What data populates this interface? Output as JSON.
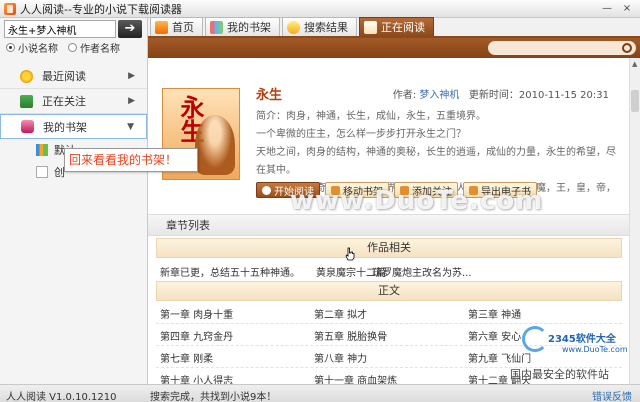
{
  "window": {
    "title": "人人阅读--专业的小说下载阅读器",
    "minimize": "—",
    "close": "×"
  },
  "search": {
    "value": "永生+梦入神机",
    "go": "➔",
    "option_title": "小说名称",
    "option_author": "作者名称"
  },
  "nav": {
    "recent": "最近阅读",
    "follow": "正在关注",
    "shelf": "我的书架",
    "sub_default": "默认",
    "sub_create": "创"
  },
  "tooltip": "回来看看我的书架！",
  "tabs": {
    "home": "首页",
    "shelf": "我的书架",
    "results": "搜索结果",
    "reading": "正在阅读"
  },
  "book": {
    "cover_title": "永生",
    "title": "永生",
    "author_label": "作者:",
    "author": "梦入神机",
    "updated_label": "更新时间：",
    "updated": "2010-11-15 20:31",
    "desc_line1": "简介：肉身，神通，长生，成仙，永生，五重境界。",
    "desc_line2": "一个卑微的庄主，怎么样一步步打开永生之门？",
    "desc_line3": "天地之间，肉身的结构，神通的奥秘，长生的逍遥，成仙的力量，永生的希望，尽在其中。",
    "desc_line4": "无穷无尽的新奇法宝，崭新世界，仙道门派，人，妖，神，仙，魔，王，皇，帝，人间的爱"
  },
  "actions": {
    "start": "开始阅读",
    "move": "移动书架",
    "follow": "添加关注",
    "export": "导出电子书"
  },
  "chapters": {
    "header": "章节列表",
    "group1": "作品相关",
    "group1_items": [
      "新章已更，总结五十五种神通。",
      "黄泉魔宗十二篇",
      "疏罗魔炮主改名为苏..."
    ],
    "group2": "正文",
    "rows": [
      [
        "第一章 肉身十重",
        "第二章 拟才",
        "第三章 神通"
      ],
      [
        "第四章 九窍金丹",
        "第五章 脱胎换骨",
        "第六章 安心"
      ],
      [
        "第七章 刚柔",
        "第八章 神力",
        "第九章 飞仙门"
      ],
      [
        "第十章 小人得志",
        "第十一章 商血架炼",
        "第十二章 翻天"
      ]
    ]
  },
  "status": {
    "version": "人人阅读 V1.0.10.1210",
    "message": "搜索完成，共找到小说9本！",
    "feedback": "错误反馈"
  },
  "watermarks": {
    "duote": "www.DuoTe.com",
    "site": "2345软件大全",
    "site_url": "www.DuoTe.com",
    "slogan": "国内最安全的软件站"
  }
}
